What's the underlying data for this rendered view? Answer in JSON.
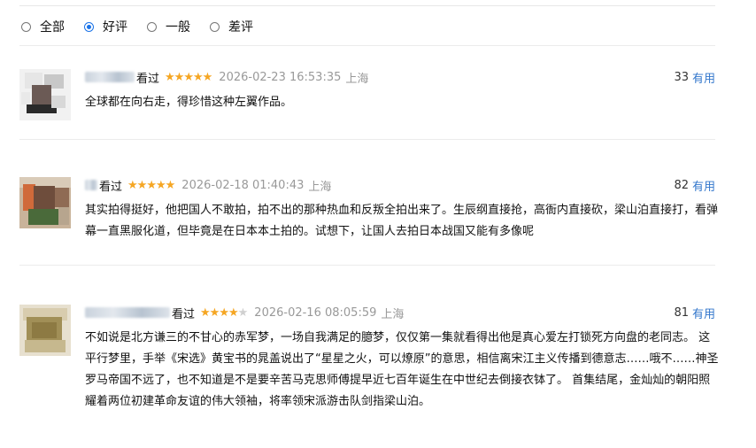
{
  "filters": [
    {
      "label": "全部",
      "checked": false
    },
    {
      "label": "好评",
      "checked": true
    },
    {
      "label": "一般",
      "checked": false
    },
    {
      "label": "差评",
      "checked": false
    }
  ],
  "comments": [
    {
      "watched": "看过",
      "stars": 5,
      "time": "2026-02-23 16:53:35",
      "location": "上海",
      "useful_count": "33",
      "useful_label": "有用",
      "text": "全球都在向右走，得珍惜这种左翼作品。"
    },
    {
      "watched": "看过",
      "stars": 5,
      "time": "2026-02-18 01:40:43",
      "location": "上海",
      "useful_count": "82",
      "useful_label": "有用",
      "text": "其实拍得挺好，他把国人不敢拍，拍不出的那种热血和反叛全拍出来了。生辰纲直接抢，高衙内直接砍，梁山泊直接打，看弹幕一直黑服化道，但毕竟是在日本本土拍的。试想下，让国人去拍日本战国又能有多像呢"
    },
    {
      "watched": "看过",
      "stars": 4,
      "time": "2026-02-16 08:05:59",
      "location": "上海",
      "useful_count": "81",
      "useful_label": "有用",
      "text": "不如说是北方谦三的不甘心的赤军梦，一场自我满足的臆梦，仅仅第一集就看得出他是真心爱左打锁死方向盘的老同志。 这平行梦里，手举《宋选》黄宝书的晁盖说出了“星星之火，可以燎原”的意思，相信离宋江主义传播到德意志……哦不……神圣罗马帝国不远了，也不知道是不是要辛苦马克思师傅提早近七百年诞生在中世纪去倒接衣钵了。 首集结尾，金灿灿的朝阳照耀着两位初建革命友谊的伟大领袖，将率领宋派游击队剑指梁山泊。"
    }
  ],
  "colors": {
    "accent": "#3377cc",
    "star": "#f5a623",
    "radio_checked": "#1a73e8"
  }
}
